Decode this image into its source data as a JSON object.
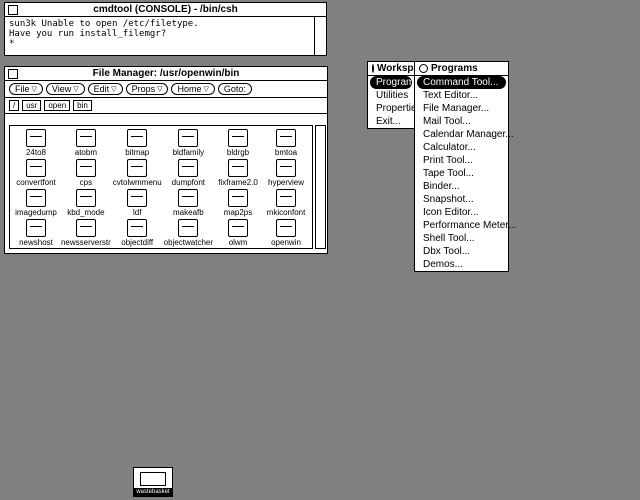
{
  "console": {
    "title": "cmdtool (CONSOLE) - /bin/csh",
    "text": "sun3k Unable to open /etc/filetype.\nHave you run install_filemgr?\n*"
  },
  "filemgr": {
    "title": "File Manager: /usr/openwin/bin",
    "buttons": {
      "file": "File",
      "view": "View",
      "edit": "Edit",
      "props": "Props",
      "home": "Home",
      "goto": "Goto:"
    },
    "path": {
      "root": "/",
      "segs": [
        "usr",
        "open",
        "bin"
      ]
    },
    "files": [
      "24to8",
      "atobm",
      "bitmap",
      "bldfamily",
      "bldrgb",
      "bmtoa",
      "convertfont",
      "cps",
      "cvtolwmmenu",
      "dumpfont",
      "fixframe2.0",
      "hyperview",
      "imagedump",
      "kbd_mode",
      "ldf",
      "makeafb",
      "map2ps",
      "mkiconfont",
      "newshost",
      "newsserverstr",
      "objectdiff",
      "objectwatcher",
      "olwm",
      "openwin"
    ]
  },
  "workspace_menu": {
    "title": "Workspa",
    "items": [
      "Programs",
      "Utilities",
      "Properties...",
      "Exit..."
    ],
    "highlighted": 0
  },
  "programs_menu": {
    "title": "Programs",
    "items": [
      "Command Tool...",
      "Text Editor...",
      "File Manager...",
      "Mail Tool...",
      "Calendar Manager...",
      "Calculator...",
      "Print Tool...",
      "Tape Tool...",
      "Binder...",
      "Snapshot...",
      "Icon Editor...",
      "Performance Meter...",
      "Shell Tool...",
      "Dbx Tool...",
      "Demos..."
    ],
    "highlighted": 0
  },
  "mini": {
    "label": "wastebasket"
  }
}
